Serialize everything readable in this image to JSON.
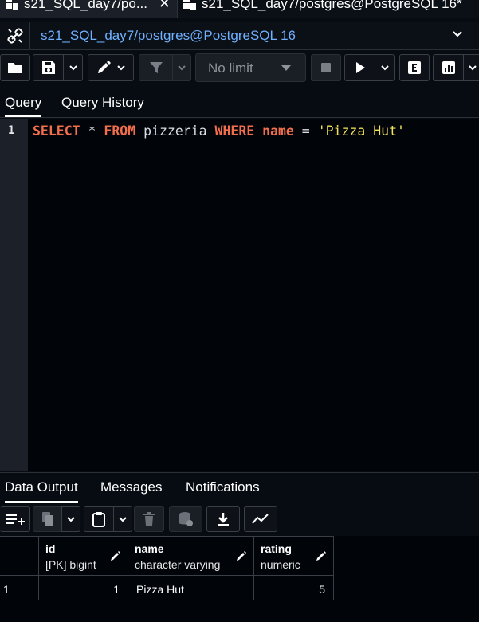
{
  "tabs": [
    {
      "title": "s21_SQL_day7/po...",
      "close": "✕",
      "icon": "database-icon"
    },
    {
      "title": "s21_SQL_day7/postgres@PostgreSQL 16*",
      "icon": "database-icon"
    }
  ],
  "connection": {
    "label": "s21_SQL_day7/postgres@PostgreSQL 16",
    "icon": "connection-icon"
  },
  "toolbar": {
    "limit_value": "No limit"
  },
  "query_tabs": [
    "Query",
    "Query History"
  ],
  "editor": {
    "line_number": "1",
    "tokens": {
      "select": "SELECT",
      "star": " * ",
      "from": "FROM",
      "table": " pizzeria ",
      "where": "WHERE",
      "space1": " ",
      "column": "name",
      "eq": " = ",
      "literal": "'Pizza Hut'"
    }
  },
  "output_tabs": [
    "Data Output",
    "Messages",
    "Notifications"
  ],
  "grid": {
    "columns": [
      {
        "name": "id",
        "type": "[PK] bigint"
      },
      {
        "name": "name",
        "type": "character varying"
      },
      {
        "name": "rating",
        "type": "numeric"
      }
    ],
    "rows": [
      {
        "row_num": "1",
        "id": "1",
        "name": "Pizza Hut",
        "rating": "5"
      }
    ]
  },
  "colors": {
    "accent_blue": "#6fb0ff",
    "keyword": "#f26e4c",
    "string": "#f2e35a",
    "background": "#070b12"
  }
}
